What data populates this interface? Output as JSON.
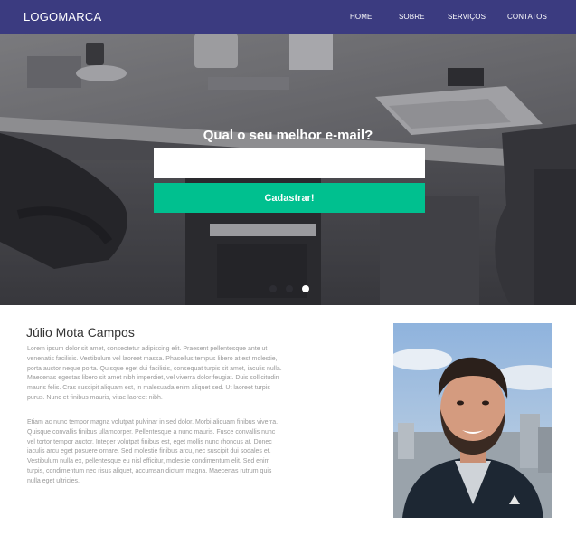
{
  "navbar": {
    "logo": "LOGOMARCA",
    "links": [
      {
        "label": "HOME",
        "icon": null
      },
      {
        "label": "SOBRE",
        "icon": null
      },
      {
        "label": "SERVIÇOS",
        "icon": null
      },
      {
        "label": "CONTATOS",
        "icon": null
      }
    ],
    "background_color": "#3b3b80"
  },
  "hero": {
    "heading": "Qual o seu melhor e-mail?",
    "email_placeholder": "",
    "email_value": "",
    "submit_label": "Cadastrar!",
    "button_color": "#00c08f",
    "carousel": {
      "slides": 3,
      "active_index": 2
    }
  },
  "about": {
    "name": "Júlio Mota Campos",
    "paragraphs": [
      "Lorem ipsum dolor sit amet, consectetur adipiscing elit. Praesent pellentesque ante ut venenatis facilisis. Vestibulum vel laoreet massa. Phasellus tempus libero at est molestie, porta auctor neque porta. Quisque eget dui facilisis, consequat turpis sit amet, iaculis nulla. Maecenas egestas libero sit amet nibh imperdiet, vel viverra dolor feugiat. Duis sollicitudin mauris felis. Cras suscipit aliquam est, in malesuada enim aliquet sed. Ut laoreet turpis purus. Nunc et finibus mauris, vitae laoreet nibh.",
      "Etiam ac nunc tempor magna volutpat pulvinar in sed dolor. Morbi aliquam finibus viverra. Quisque convallis finibus ullamcorper. Pellentesque a nunc mauris. Fusce convallis nunc vel tortor tempor auctor. Integer volutpat finibus est, eget mollis nunc rhoncus at. Donec iaculis arcu eget posuere ornare. Sed molestie finibus arcu, nec suscipit dui sodales et. Vestibulum nulla ex, pellentesque eu nisl efficitur, molestie condimentum elit. Sed enim turpis, condimentum nec risus aliquet, accumsan dictum magna. Maecenas rutrum quis nulla eget ultricies."
    ],
    "photo_icon": "profile-photo"
  }
}
